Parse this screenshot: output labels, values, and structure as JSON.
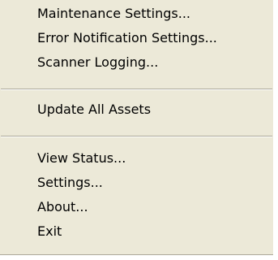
{
  "menu": {
    "group1": [
      {
        "label": "Maintenance Settings..."
      },
      {
        "label": "Error Notification Settings..."
      },
      {
        "label": "Scanner Logging..."
      }
    ],
    "group2": [
      {
        "label": "Update All Assets"
      }
    ],
    "group3": [
      {
        "label": "View Status..."
      },
      {
        "label": "Settings..."
      },
      {
        "label": "About..."
      },
      {
        "label": "Exit"
      }
    ]
  },
  "colors": {
    "menu_background": "#ece9d8",
    "separator_dark": "#aca899",
    "separator_light": "#ffffff",
    "text": "#000000"
  }
}
